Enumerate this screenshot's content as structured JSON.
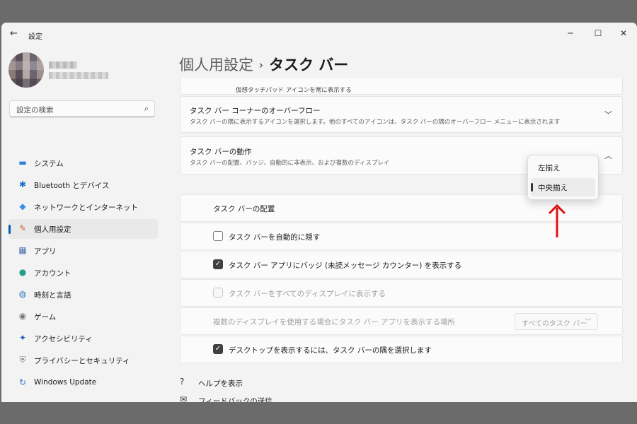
{
  "window": {
    "title": "設定",
    "back_glyph": "←",
    "minimize_glyph": "─",
    "maximize_glyph": "☐",
    "close_glyph": "✕"
  },
  "search": {
    "placeholder": "設定の検索",
    "icon": "search-icon"
  },
  "sidebar": {
    "items": [
      {
        "label": "システム",
        "icon": "monitor-icon",
        "glyph": "▬",
        "color": "#2b7fd8"
      },
      {
        "label": "Bluetooth とデバイス",
        "icon": "bluetooth-icon",
        "glyph": "✱",
        "color": "#1a6fc9"
      },
      {
        "label": "ネットワークとインターネット",
        "icon": "wifi-icon",
        "glyph": "◆",
        "color": "#3a8ee8"
      },
      {
        "label": "個人用設定",
        "icon": "brush-icon",
        "glyph": "✎",
        "color": "#c86a2c"
      },
      {
        "label": "アプリ",
        "icon": "apps-icon",
        "glyph": "▦",
        "color": "#4a6ea8"
      },
      {
        "label": "アカウント",
        "icon": "account-icon",
        "glyph": "●",
        "color": "#23a08a"
      },
      {
        "label": "時刻と言語",
        "icon": "globe-clock-icon",
        "glyph": "◍",
        "color": "#2d7fc7"
      },
      {
        "label": "ゲーム",
        "icon": "gamepad-icon",
        "glyph": "◉",
        "color": "#7a7a7a"
      },
      {
        "label": "アクセシビリティ",
        "icon": "accessibility-icon",
        "glyph": "✦",
        "color": "#1d5fb8"
      },
      {
        "label": "プライバシーとセキュリティ",
        "icon": "shield-icon",
        "glyph": "⛨",
        "color": "#7c7c7c"
      },
      {
        "label": "Windows Update",
        "icon": "update-icon",
        "glyph": "↻",
        "color": "#1f74c9"
      }
    ],
    "selected_index": 3
  },
  "breadcrumb": {
    "parent": "個人用設定",
    "separator": "›",
    "current": "タスク バー"
  },
  "partial_row": {
    "label": "仮想タッチパッド アイコンを常に表示する"
  },
  "overflow_card": {
    "title": "タスク バー コーナーのオーバーフロー",
    "subtitle": "タスク バーの隅に表示するアイコンを選択します。他のすべてのアイコンは、タスク バーの隅のオーバーフロー メニューに表示されます",
    "chevron": "﹀"
  },
  "behavior_card": {
    "title": "タスク バーの動作",
    "subtitle": "タスク バーの配置、バッジ、自動的に非表示、および複数のディスプレイ",
    "chevron": "︿"
  },
  "behavior_rows": {
    "alignment_label": "タスク バーの配置",
    "autohide_label": "タスク バーを自動的に隠す",
    "badges_label": "タスク バー アプリにバッジ (未読メッセージ カウンター) を表示する",
    "all_displays_label": "タスク バーをすべてのディスプレイに表示する",
    "multi_display_label": "複数のディスプレイを使用する場合にタスク バー アプリを表示する場所",
    "multi_display_value": "すべてのタスク バー",
    "desktop_corner_label": "デスクトップを表示するには、タスク バーの隅を選択します",
    "checkmark": "✓",
    "dropdown_chevron": "﹀"
  },
  "checkbox_states": {
    "autohide": false,
    "badges": true,
    "all_displays": false,
    "desktop_corner": true
  },
  "alignment_popup": {
    "options": [
      "左揃え",
      "中央揃え"
    ],
    "selected": "中央揃え"
  },
  "footer_links": {
    "help": {
      "label": "ヘルプを表示",
      "icon": "help-icon",
      "glyph": "?"
    },
    "feedback": {
      "label": "フィードバックの送信",
      "icon": "feedback-icon",
      "glyph": "✉"
    }
  },
  "colors": {
    "accent": "#005fb8",
    "annotation_arrow": "#e01010",
    "card": "#fbfbfb",
    "window": "#f3f3f3"
  }
}
